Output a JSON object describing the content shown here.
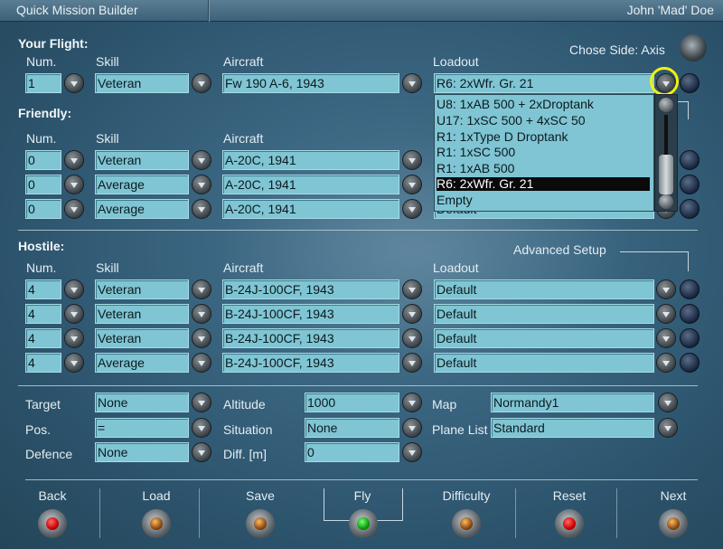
{
  "titlebar": {
    "app": "Quick Mission Builder",
    "user": "John 'Mad' Doe"
  },
  "side": {
    "label": "Chose Side: Axis"
  },
  "cols": {
    "num": "Num.",
    "skill": "Skill",
    "aircraft": "Aircraft",
    "loadout": "Loadout"
  },
  "your_flight": {
    "title": "Your Flight:",
    "num": "1",
    "skill": "Veteran",
    "aircraft": "Fw 190 A-6, 1943",
    "loadout": "R6: 2xWfr. Gr. 21"
  },
  "loadout_options": [
    "U8: 1xAB 500 + 2xDroptank",
    "U17: 1xSC 500 + 4xSC 50",
    "R1: 1xType D Droptank",
    "R1: 1xSC 500",
    "R1: 1xAB 500",
    "R6: 2xWfr. Gr. 21",
    "Empty"
  ],
  "friendly": {
    "title": "Friendly:",
    "rows": [
      {
        "num": "0",
        "skill": "Veteran",
        "aircraft": "A-20C, 1941",
        "loadout": ""
      },
      {
        "num": "0",
        "skill": "Average",
        "aircraft": "A-20C, 1941",
        "loadout": ""
      },
      {
        "num": "0",
        "skill": "Average",
        "aircraft": "A-20C, 1941",
        "loadout": "Default"
      }
    ]
  },
  "hostile": {
    "title": "Hostile:",
    "advanced": "Advanced Setup",
    "rows": [
      {
        "num": "4",
        "skill": "Veteran",
        "aircraft": "B-24J-100CF, 1943",
        "loadout": "Default"
      },
      {
        "num": "4",
        "skill": "Veteran",
        "aircraft": "B-24J-100CF, 1943",
        "loadout": "Default"
      },
      {
        "num": "4",
        "skill": "Veteran",
        "aircraft": "B-24J-100CF, 1943",
        "loadout": "Default"
      },
      {
        "num": "4",
        "skill": "Average",
        "aircraft": "B-24J-100CF, 1943",
        "loadout": "Default"
      }
    ]
  },
  "mission": {
    "target_label": "Target",
    "target": "None",
    "pos_label": "Pos.",
    "pos": "=",
    "defence_label": "Defence",
    "defence": "None",
    "altitude_label": "Altitude",
    "altitude": "1000",
    "situation_label": "Situation",
    "situation": "None",
    "diff_label": "Diff. [m]",
    "diff": "0",
    "map_label": "Map",
    "map": "Normandy1",
    "planelist_label": "Plane List",
    "planelist": "Standard"
  },
  "buttons": {
    "back": "Back",
    "load": "Load",
    "save": "Save",
    "fly": "Fly",
    "difficulty": "Difficulty",
    "reset": "Reset",
    "next": "Next"
  }
}
